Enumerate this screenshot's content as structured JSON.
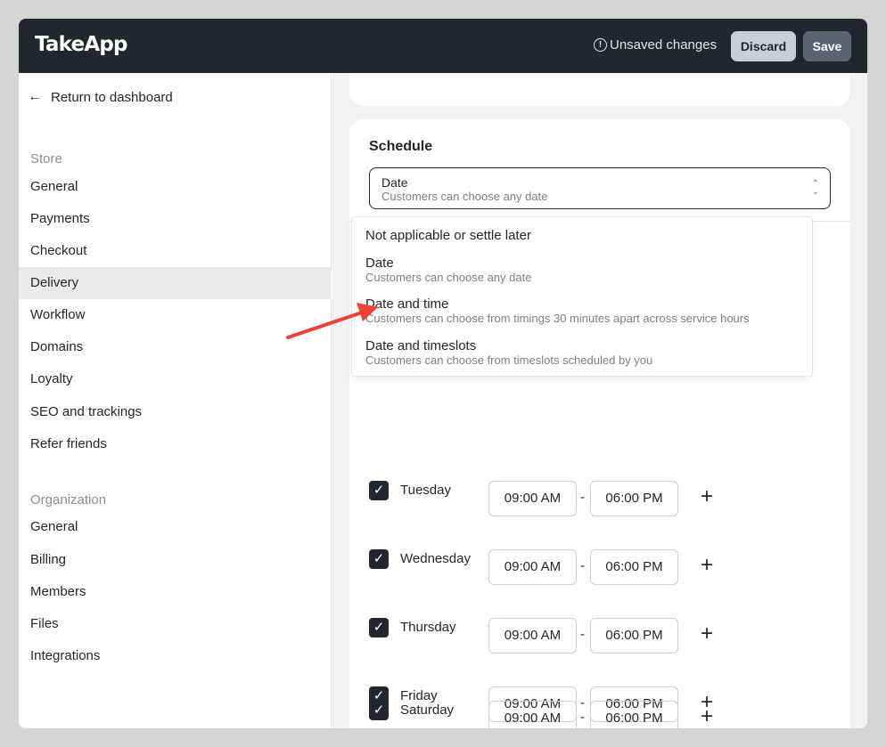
{
  "topbar": {
    "logo": "TakeApp",
    "unsaved": "Unsaved changes",
    "discard": "Discard",
    "save": "Save"
  },
  "sidebar": {
    "return": "Return to dashboard",
    "store_label": "Store",
    "store_items": [
      "General",
      "Payments",
      "Checkout",
      "Delivery",
      "Workflow",
      "Domains",
      "Loyalty",
      "SEO and trackings",
      "Refer friends"
    ],
    "active_item": "Delivery",
    "org_label": "Organization",
    "org_items": [
      "General",
      "Billing",
      "Members",
      "Files",
      "Integrations"
    ]
  },
  "schedule": {
    "title": "Schedule",
    "selected": {
      "label": "Date",
      "description": "Customers can choose any date"
    },
    "options": [
      {
        "label": "Not applicable or settle later",
        "description": ""
      },
      {
        "label": "Date",
        "description": "Customers can choose any date"
      },
      {
        "label": "Date and time",
        "description": "Customers can choose from timings 30 minutes apart across service hours"
      },
      {
        "label": "Date and timeslots",
        "description": "Customers can choose from timeslots scheduled by you"
      }
    ]
  },
  "days": [
    {
      "name": "Tuesday",
      "checked": true,
      "start": "09:00 AM",
      "end": "06:00 PM"
    },
    {
      "name": "Wednesday",
      "checked": true,
      "start": "09:00 AM",
      "end": "06:00 PM"
    },
    {
      "name": "Thursday",
      "checked": true,
      "start": "09:00 AM",
      "end": "06:00 PM"
    },
    {
      "name": "Friday",
      "checked": true,
      "start": "09:00 AM",
      "end": "06:00 PM"
    },
    {
      "name": "Saturday",
      "checked": true,
      "start": "09:00 AM",
      "end": "06:00 PM"
    }
  ],
  "colors": {
    "topbar": "#22262d",
    "accent": "#22262d",
    "annotation_arrow": "#ef4136"
  }
}
